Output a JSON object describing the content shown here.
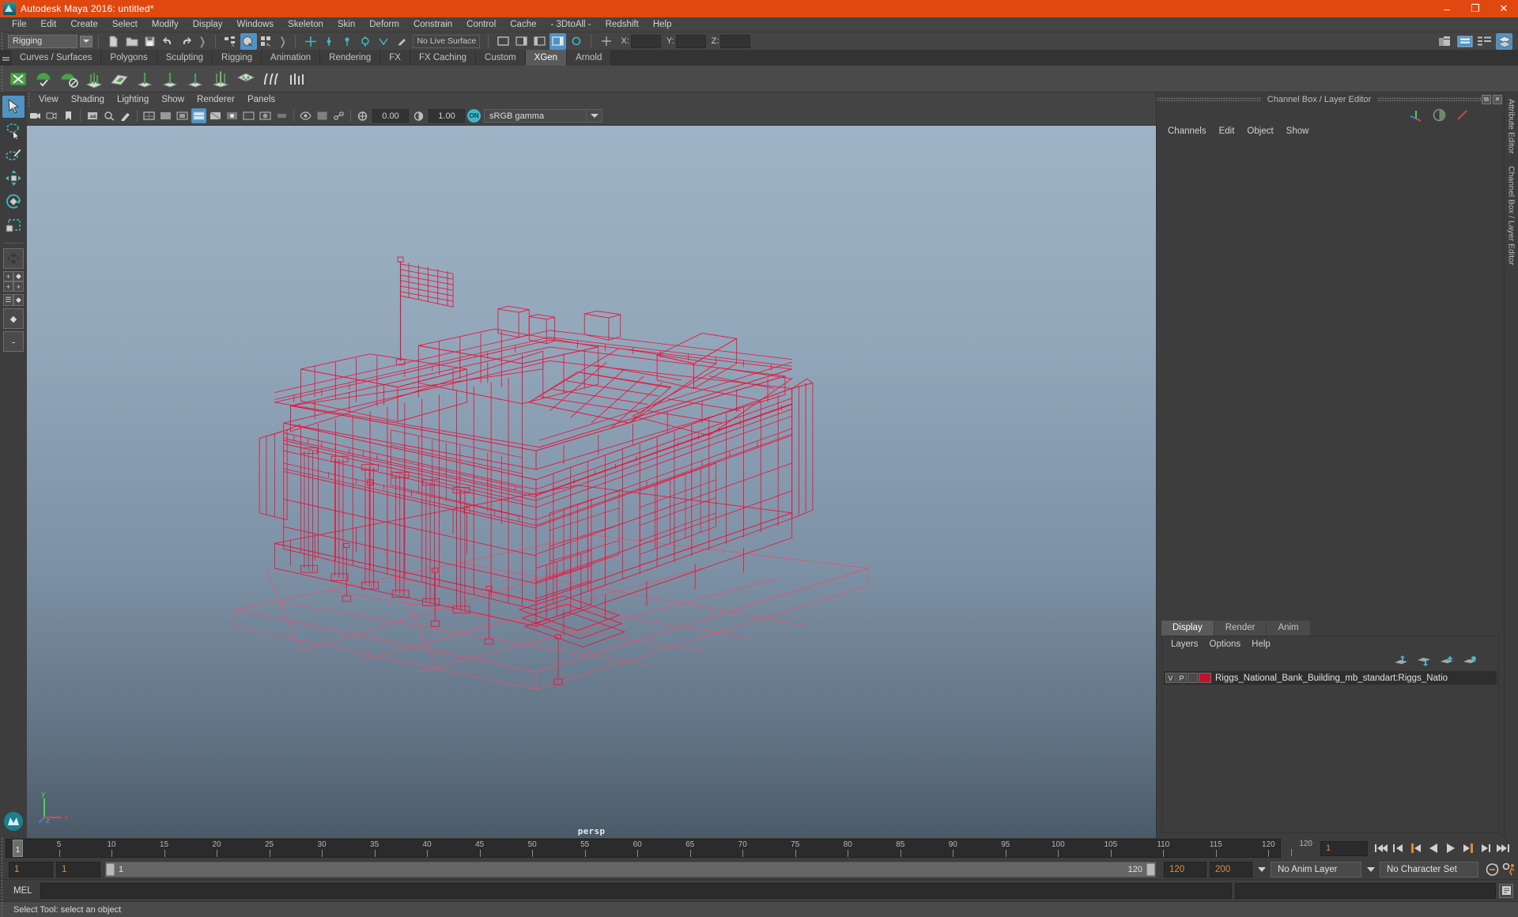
{
  "window": {
    "title": "Autodesk Maya 2016: untitled*",
    "logo_icon": "maya-logo-icon",
    "minimize_label": "–",
    "maximize_label": "❐",
    "close_label": "✕"
  },
  "menubar": {
    "items": [
      {
        "label": "File"
      },
      {
        "label": "Edit"
      },
      {
        "label": "Create"
      },
      {
        "label": "Select"
      },
      {
        "label": "Modify"
      },
      {
        "label": "Display"
      },
      {
        "label": "Windows"
      },
      {
        "label": "Skeleton"
      },
      {
        "label": "Skin"
      },
      {
        "label": "Deform"
      },
      {
        "label": "Constrain"
      },
      {
        "label": "Control"
      },
      {
        "label": "Cache"
      },
      {
        "label": "- 3DtoAll -"
      },
      {
        "label": "Redshift"
      },
      {
        "label": "Help"
      }
    ]
  },
  "statusline": {
    "menu_set": "Rigging",
    "live_surface": "No Live Surface",
    "coord_x_label": "X:",
    "coord_y_label": "Y:",
    "coord_z_label": "Z:",
    "coord_x_value": "",
    "coord_y_value": "",
    "coord_z_value": ""
  },
  "shelf": {
    "tabs": [
      {
        "label": "Curves / Surfaces",
        "active": false
      },
      {
        "label": "Polygons",
        "active": false
      },
      {
        "label": "Sculpting",
        "active": false
      },
      {
        "label": "Rigging",
        "active": false
      },
      {
        "label": "Animation",
        "active": false
      },
      {
        "label": "Rendering",
        "active": false
      },
      {
        "label": "FX",
        "active": false
      },
      {
        "label": "FX Caching",
        "active": false
      },
      {
        "label": "Custom",
        "active": false
      },
      {
        "label": "XGen",
        "active": true
      },
      {
        "label": "Arnold",
        "active": false
      }
    ]
  },
  "viewport": {
    "menus": [
      {
        "label": "View"
      },
      {
        "label": "Shading"
      },
      {
        "label": "Lighting"
      },
      {
        "label": "Show"
      },
      {
        "label": "Renderer"
      },
      {
        "label": "Panels"
      }
    ],
    "exposure_value": "0.00",
    "gamma_value": "1.00",
    "color_toggle_label": "ON",
    "color_profile": "sRGB gamma",
    "camera_label": "persp",
    "axis_x_label": "x",
    "axis_y_label": "y",
    "axis_z_label": "z",
    "wireframe_color": "#e8153a",
    "ground_grid_color": "#e0566f"
  },
  "channelbox": {
    "panel_title": "Channel Box / Layer Editor",
    "restore_label": "⧉",
    "close_label": "✕",
    "menus": [
      {
        "label": "Channels"
      },
      {
        "label": "Edit"
      },
      {
        "label": "Object"
      },
      {
        "label": "Show"
      }
    ]
  },
  "layereditor": {
    "tabs": [
      {
        "label": "Display",
        "active": true
      },
      {
        "label": "Render",
        "active": false
      },
      {
        "label": "Anim",
        "active": false
      }
    ],
    "menus": [
      {
        "label": "Layers"
      },
      {
        "label": "Options"
      },
      {
        "label": "Help"
      }
    ],
    "layers": [
      {
        "visibility": "V",
        "playback": "P",
        "state": "",
        "color": "#c2122f",
        "name": "Riggs_National_Bank_Building_mb_standart:Riggs_Natio"
      }
    ]
  },
  "right_sidebar": {
    "attribute_editor_label": "Attribute Editor",
    "channel_box_label": "Channel Box / Layer Editor"
  },
  "timeline": {
    "current_frame": "1",
    "current_frame_field": "1",
    "tick_labels": [
      "5",
      "10",
      "15",
      "20",
      "25",
      "30",
      "35",
      "40",
      "45",
      "50",
      "55",
      "60",
      "65",
      "70",
      "75",
      "80",
      "85",
      "90",
      "95",
      "100",
      "105",
      "110",
      "115",
      "120"
    ],
    "end_tick_label": "120",
    "playback_buttons": [
      {
        "name": "go-to-start-button",
        "glyph": "rewind-start"
      },
      {
        "name": "step-back-key-button",
        "glyph": "prev-key"
      },
      {
        "name": "step-back-frame-button",
        "glyph": "prev-frame"
      },
      {
        "name": "play-backwards-button",
        "glyph": "play-back"
      },
      {
        "name": "play-forwards-button",
        "glyph": "play-fwd"
      },
      {
        "name": "step-forward-frame-button",
        "glyph": "next-frame"
      },
      {
        "name": "step-forward-key-button",
        "glyph": "next-key"
      },
      {
        "name": "go-to-end-button",
        "glyph": "rewind-end"
      }
    ]
  },
  "rangeslider": {
    "anim_start": "1",
    "range_start": "1",
    "slider_left_label": "1",
    "slider_right_label": "120",
    "range_end": "120",
    "anim_end": "200",
    "anim_layer": "No Anim Layer",
    "character_set": "No Character Set",
    "auto_key_icon": "auto-key-icon",
    "anim_prefs_icon": "animation-preferences-icon"
  },
  "commandline": {
    "language_label": "MEL",
    "input_value": "",
    "output_value": "",
    "help_icon": "script-editor-icon"
  },
  "statusbar": {
    "message": "Select Tool: select an object"
  },
  "toolbox": {
    "tools": [
      {
        "name": "select-tool",
        "icon": "arrow-cursor-icon",
        "selected": true
      },
      {
        "name": "lasso-select-tool",
        "icon": "lasso-icon",
        "selected": false
      },
      {
        "name": "paint-select-tool",
        "icon": "paint-brush-icon",
        "selected": false
      },
      {
        "name": "move-tool",
        "icon": "move-arrows-icon",
        "selected": false
      },
      {
        "name": "rotate-tool",
        "icon": "rotate-icon",
        "selected": false
      },
      {
        "name": "scale-tool",
        "icon": "scale-icon",
        "selected": false
      }
    ],
    "layouts": [
      {
        "name": "single-perspective-layout",
        "icon": "single-view-icon"
      },
      {
        "name": "four-view-layout",
        "icon": "four-view-icon"
      },
      {
        "name": "outliner-persp-layout",
        "icon": "outliner-persp-icon"
      },
      {
        "name": "persp-graph-layout",
        "icon": "persp-graph-icon"
      }
    ],
    "maya_logo": "maya-logo-icon"
  },
  "colors": {
    "title_bar": "#e0480f",
    "chrome": "#3d3d3d",
    "panel": "#444444",
    "accent_blue": "#4f93c4",
    "accent_orange": "#e08a3c",
    "shelf_green": "#4e9e4e",
    "layer_red": "#c2122f"
  }
}
